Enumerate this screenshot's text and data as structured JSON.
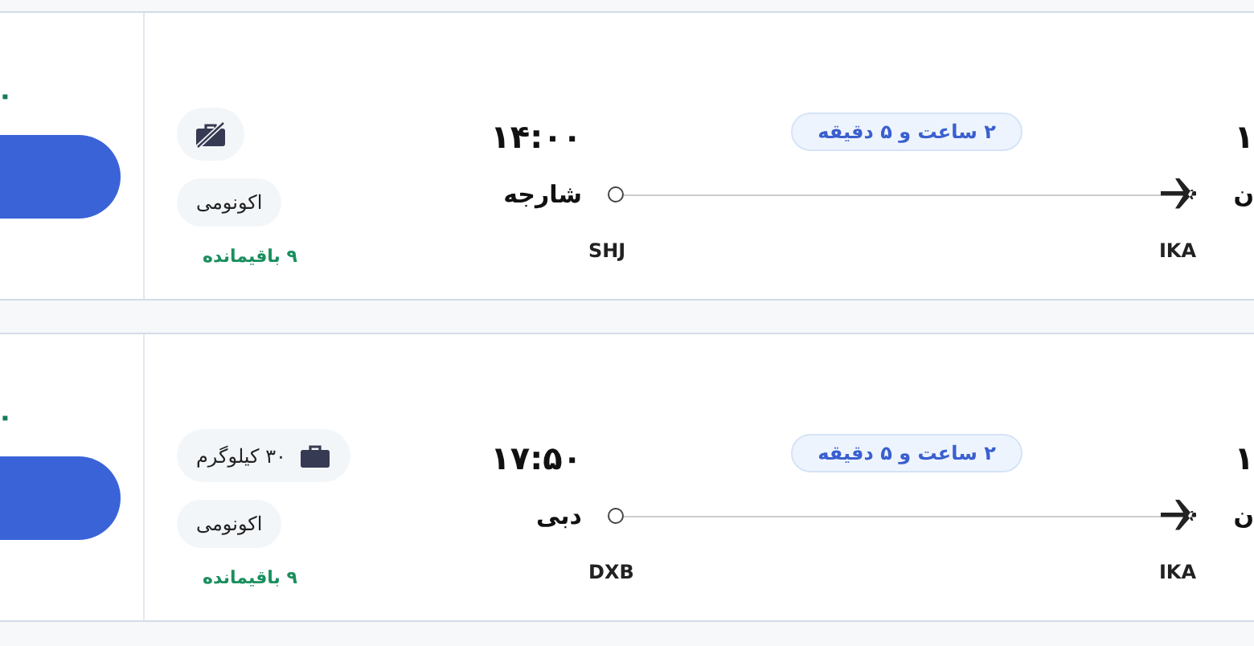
{
  "flights": [
    {
      "price": "۰",
      "baggage": {
        "kind": "none"
      },
      "cabin_class": "اکونومی",
      "seats_left": "۹ باقیمانده",
      "arrival_time": "۱۴:۰۰",
      "arrival_city": "شارجه",
      "arrival_code": "SHJ",
      "duration": "۲ ساعت و ۵ دقیقه",
      "departure_code": "IKA",
      "departure_time": "۱",
      "departure_city": "ن"
    },
    {
      "price": "۰",
      "baggage": {
        "kind": "allowance",
        "text": "۳۰ کیلوگرم"
      },
      "cabin_class": "اکونومی",
      "seats_left": "۹ باقیمانده",
      "arrival_time": "۱۷:۵۰",
      "arrival_city": "دبی",
      "arrival_code": "DXB",
      "duration": "۲ ساعت و ۵ دقیقه",
      "departure_code": "IKA",
      "departure_time": "۱",
      "departure_city": "ن"
    }
  ]
}
